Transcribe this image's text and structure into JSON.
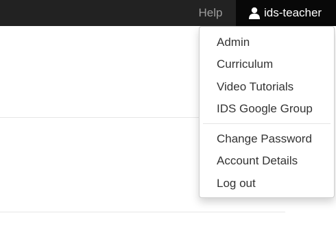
{
  "navbar": {
    "help_label": "Help",
    "user_label": "ids-teacher",
    "user_icon": "user-icon"
  },
  "dropdown": {
    "group1": [
      {
        "label": "Admin"
      },
      {
        "label": "Curriculum"
      },
      {
        "label": "Video Tutorials"
      },
      {
        "label": "IDS Google Group"
      }
    ],
    "group2": [
      {
        "label": "Change Password"
      },
      {
        "label": "Account Details"
      },
      {
        "label": "Log out"
      }
    ]
  },
  "colors": {
    "navbar_bg": "#222222",
    "active_nav_bg": "#080808",
    "nav_text_muted": "#9d9d9d",
    "dropdown_text": "#333333"
  }
}
